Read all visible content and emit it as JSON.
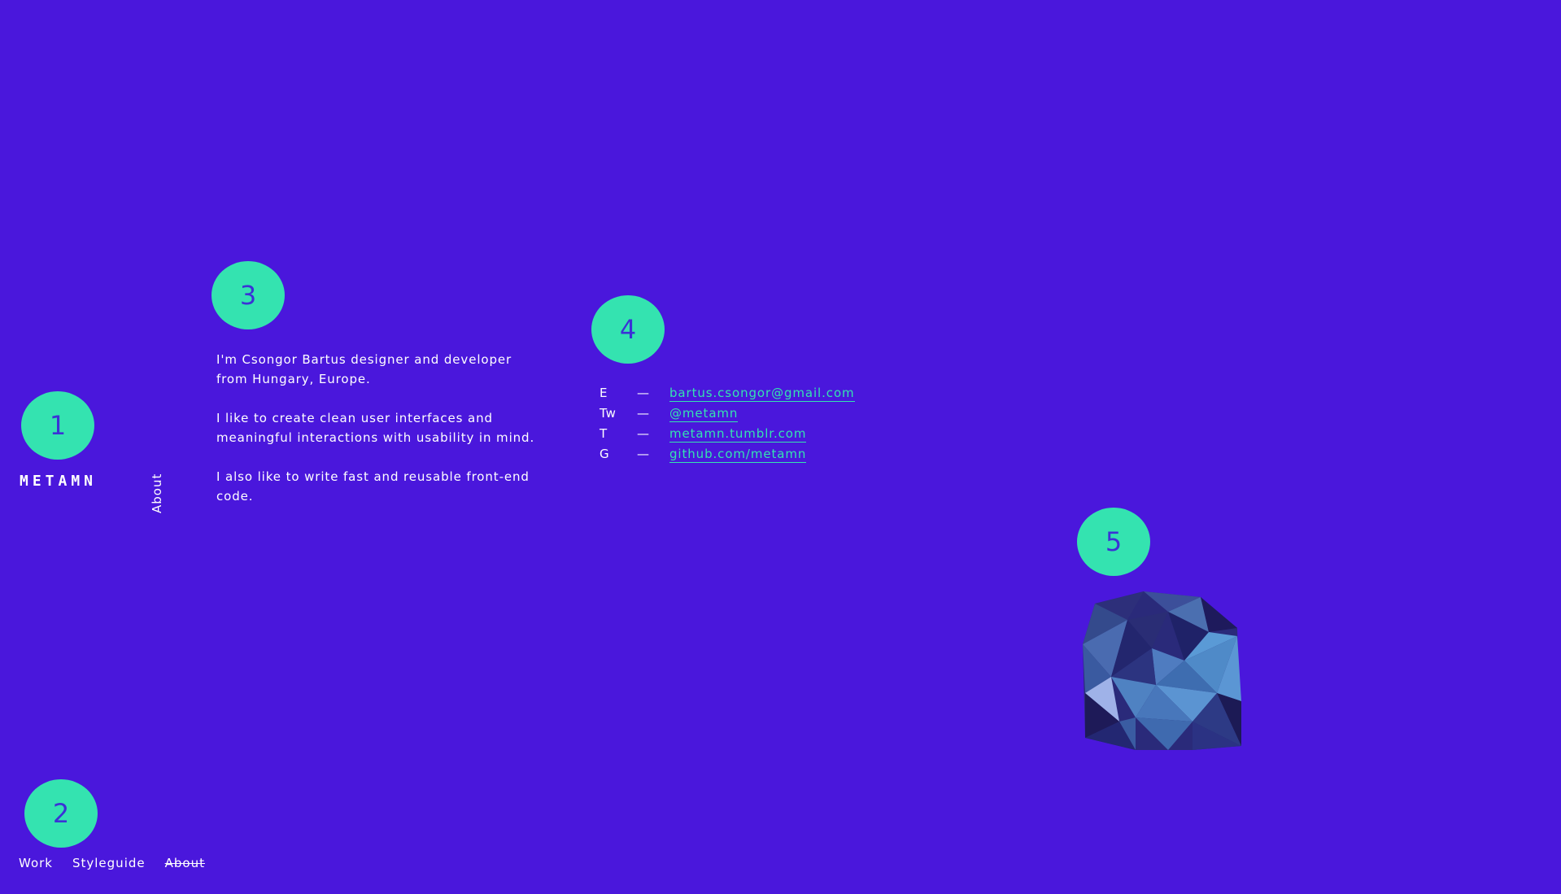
{
  "colors": {
    "background": "#4a17dc",
    "accent": "#34e3b0",
    "marker_text": "#3b32d6",
    "text": "#ffffff"
  },
  "markers": {
    "m1": "1",
    "m2": "2",
    "m3": "3",
    "m4": "4",
    "m5": "5"
  },
  "logo": "METAMN",
  "vertical_label": "About",
  "bio": {
    "p1": "I'm Csongor Bartus designer and developer from Hungary, Europe.",
    "p2": "I like to create clean user interfaces and meaningful interactions with usability in mind.",
    "p3": "I also like to write fast and reusable front-end code."
  },
  "contacts": [
    {
      "key": "E",
      "dash": "—",
      "value": "bartus.csongor@gmail.com"
    },
    {
      "key": "Tw",
      "dash": "—",
      "value": "@metamn"
    },
    {
      "key": "T",
      "dash": "—",
      "value": "metamn.tumblr.com"
    },
    {
      "key": "G",
      "dash": "—",
      "value": "github.com/metamn"
    }
  ],
  "nav": {
    "work": "Work",
    "styleguide": "Styleguide",
    "about": "About"
  },
  "crystal": {
    "icon": "polygon-crystal-icon"
  }
}
